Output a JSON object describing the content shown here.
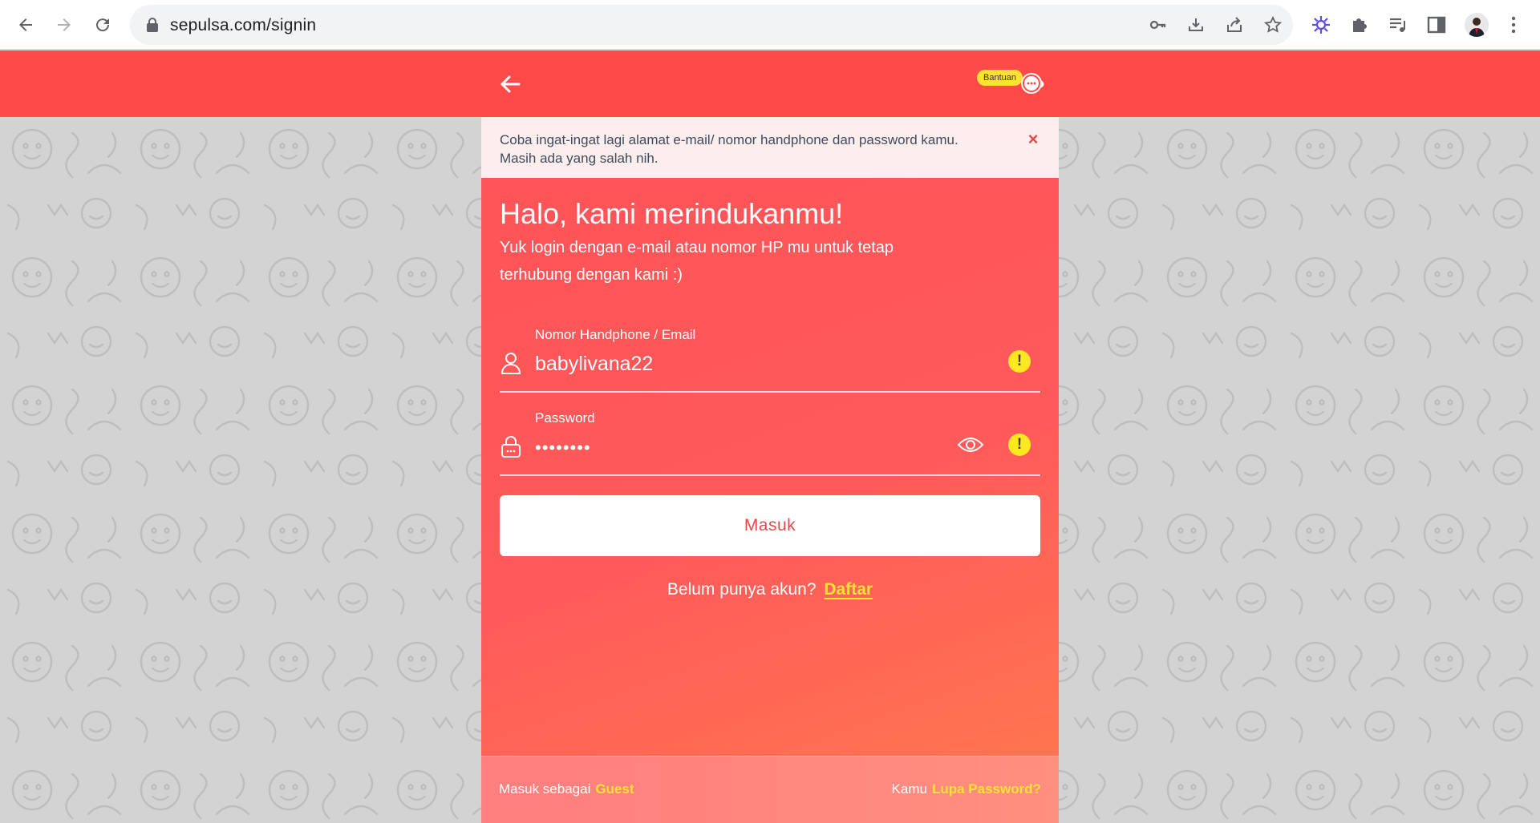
{
  "browser": {
    "url": "sepulsa.com/signin",
    "icons": [
      "back-icon",
      "forward-icon",
      "reload-icon",
      "lock-icon",
      "key-icon",
      "install-icon",
      "share-icon",
      "star-icon",
      "extension-gear-icon",
      "puzzle-icon",
      "media-icon",
      "sidepanel-icon",
      "avatar",
      "menu-icon"
    ]
  },
  "header": {
    "help_label": "Bantuan",
    "back_icon": "arrow-left-icon",
    "help_icon": "chat-bubble-icon",
    "bg_color": "#ff4a4a"
  },
  "alert": {
    "message": "Coba ingat-ingat lagi alamat e-mail/ nomor handphone dan password kamu. Masih ada yang salah nih.",
    "close_glyph": "×"
  },
  "login": {
    "title": "Halo, kami merindukanmu!",
    "subtitle": "Yuk login dengan e-mail atau nomor HP mu untuk tetap terhubung dengan kami :)",
    "username_label": "Nomor Handphone / Email",
    "username_value": "babylivana22",
    "password_label": "Password",
    "password_value": "••••••••",
    "warn_glyph": "!",
    "submit_label": "Masuk",
    "register_prompt": "Belum punya akun?",
    "register_link": "Daftar"
  },
  "footer": {
    "guest_prefix": "Masuk sebagai",
    "guest_link": "Guest",
    "forgot_prefix": "Kamu",
    "forgot_link": "Lupa Password?"
  },
  "colors": {
    "accent": "#ff4a4a",
    "link_yellow": "#ffe234",
    "alert_bg": "#fdeeee"
  }
}
